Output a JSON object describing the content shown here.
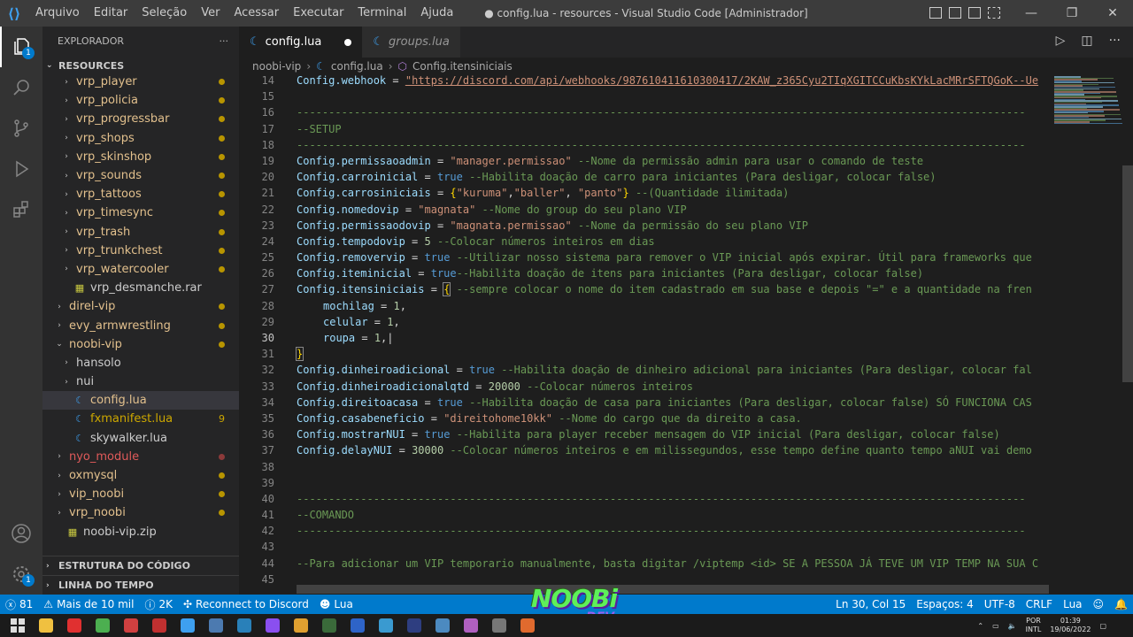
{
  "titlebar": {
    "menu": [
      "Arquivo",
      "Editar",
      "Seleção",
      "Ver",
      "Acessar",
      "Executar",
      "Terminal",
      "Ajuda"
    ],
    "title": "● config.lua - resources - Visual Studio Code [Administrador]"
  },
  "activitybar": {
    "explorer_badge": "1",
    "accounts_badge": "1"
  },
  "sidebar": {
    "title": "EXPLORADOR",
    "more": "···",
    "root": "RESOURCES",
    "items": [
      {
        "label": "vrp_player",
        "depth": 1,
        "twist": "›",
        "color": "#e2c08d",
        "dot": "#b89500"
      },
      {
        "label": "vrp_policia",
        "depth": 1,
        "twist": "›",
        "color": "#e2c08d",
        "dot": "#b89500"
      },
      {
        "label": "vrp_progressbar",
        "depth": 1,
        "twist": "›",
        "color": "#e2c08d",
        "dot": "#b89500"
      },
      {
        "label": "vrp_shops",
        "depth": 1,
        "twist": "›",
        "color": "#e2c08d",
        "dot": "#b89500"
      },
      {
        "label": "vrp_skinshop",
        "depth": 1,
        "twist": "›",
        "color": "#e2c08d",
        "dot": "#b89500"
      },
      {
        "label": "vrp_sounds",
        "depth": 1,
        "twist": "›",
        "color": "#e2c08d",
        "dot": "#b89500"
      },
      {
        "label": "vrp_tattoos",
        "depth": 1,
        "twist": "›",
        "color": "#e2c08d",
        "dot": "#b89500"
      },
      {
        "label": "vrp_timesync",
        "depth": 1,
        "twist": "›",
        "color": "#e2c08d",
        "dot": "#b89500"
      },
      {
        "label": "vrp_trash",
        "depth": 1,
        "twist": "›",
        "color": "#e2c08d",
        "dot": "#b89500"
      },
      {
        "label": "vrp_trunkchest",
        "depth": 1,
        "twist": "›",
        "color": "#e2c08d",
        "dot": "#b89500"
      },
      {
        "label": "vrp_watercooler",
        "depth": 1,
        "twist": "›",
        "color": "#e2c08d",
        "dot": "#b89500"
      },
      {
        "label": "vrp_desmanche.rar",
        "depth": 1,
        "twist": "",
        "icon": "▦",
        "icon_color": "#cbcb41",
        "color": "#cccccc"
      },
      {
        "label": "direl-vip",
        "depth": 0,
        "twist": "›",
        "color": "#e2c08d",
        "dot": "#b89500"
      },
      {
        "label": "evy_armwrestling",
        "depth": 0,
        "twist": "›",
        "color": "#e2c08d",
        "dot": "#b89500"
      },
      {
        "label": "noobi-vip",
        "depth": 0,
        "twist": "⌄",
        "color": "#e2c08d",
        "dot": "#b89500"
      },
      {
        "label": "hansolo",
        "depth": 1,
        "twist": "›",
        "color": "#cccccc"
      },
      {
        "label": "nui",
        "depth": 1,
        "twist": "›",
        "color": "#cccccc"
      },
      {
        "label": "config.lua",
        "depth": 1,
        "twist": "",
        "icon": "☾",
        "icon_color": "#3ea0f0",
        "color": "#e2c08d",
        "selected": true
      },
      {
        "label": "fxmanifest.lua",
        "depth": 1,
        "twist": "",
        "icon": "☾",
        "icon_color": "#3ea0f0",
        "color": "#cca700",
        "count": "9"
      },
      {
        "label": "skywalker.lua",
        "depth": 1,
        "twist": "",
        "icon": "☾",
        "icon_color": "#3ea0f0",
        "color": "#cccccc"
      },
      {
        "label": "nyo_module",
        "depth": 0,
        "twist": "›",
        "color": "#e05a5a",
        "dot": "#8c3a3a"
      },
      {
        "label": "oxmysql",
        "depth": 0,
        "twist": "›",
        "color": "#e2c08d",
        "dot": "#b89500"
      },
      {
        "label": "vip_noobi",
        "depth": 0,
        "twist": "›",
        "color": "#e2c08d",
        "dot": "#b89500"
      },
      {
        "label": "vrp_noobi",
        "depth": 0,
        "twist": "›",
        "color": "#e2c08d",
        "dot": "#b89500"
      },
      {
        "label": "noobi-vip.zip",
        "depth": 0,
        "twist": "",
        "icon": "▦",
        "icon_color": "#cbcb41",
        "color": "#cccccc"
      }
    ],
    "outline": "ESTRUTURA DO CÓDIGO",
    "timeline": "LINHA DO TEMPO"
  },
  "tabs": [
    {
      "label": "config.lua",
      "active": true,
      "modified": true
    },
    {
      "label": "groups.lua",
      "active": false
    }
  ],
  "breadcrumb": {
    "folder": "noobi-vip",
    "file": "config.lua",
    "symbol": "Config.itensiniciais"
  },
  "editor": {
    "lines": [
      {
        "n": 14,
        "t": [
          [
            "v",
            "Config.webhook"
          ],
          [
            "p",
            " = "
          ],
          [
            "u",
            "\"https://discord.com/api/webhooks/987610411610300417/2KAW_z365Cyu2TIqXGITCCuKbsKYkLacMRrSFTQGoK--Ue"
          ]
        ]
      },
      {
        "n": 15,
        "t": []
      },
      {
        "n": 16,
        "t": [
          [
            "c",
            "------------------------------------------------------------------------------------------------------------------"
          ]
        ]
      },
      {
        "n": 17,
        "t": [
          [
            "c",
            "--SETUP"
          ]
        ]
      },
      {
        "n": 18,
        "t": [
          [
            "c",
            "------------------------------------------------------------------------------------------------------------------"
          ]
        ]
      },
      {
        "n": 19,
        "t": [
          [
            "v",
            "Config.permissaoadmin"
          ],
          [
            "p",
            " = "
          ],
          [
            "s",
            "\"manager.permissao\""
          ],
          [
            "c",
            " --Nome da permissão admin para usar o comando de teste"
          ]
        ]
      },
      {
        "n": 20,
        "t": [
          [
            "v",
            "Config.carroinicial"
          ],
          [
            "p",
            " = "
          ],
          [
            "k",
            "true"
          ],
          [
            "c",
            " --Habilita doação de carro para iniciantes (Para desligar, colocar false)"
          ]
        ]
      },
      {
        "n": 21,
        "t": [
          [
            "v",
            "Config.carrosiniciais"
          ],
          [
            "p",
            " = "
          ],
          [
            "b",
            "{"
          ],
          [
            "s",
            "\"kuruma\""
          ],
          [
            "p",
            ","
          ],
          [
            "s",
            "\"baller\""
          ],
          [
            "p",
            ", "
          ],
          [
            "s",
            "\"panto\""
          ],
          [
            "b",
            "}"
          ],
          [
            "c",
            " --(Quantidade ilimitada)"
          ]
        ]
      },
      {
        "n": 22,
        "t": [
          [
            "v",
            "Config.nomedovip"
          ],
          [
            "p",
            " = "
          ],
          [
            "s",
            "\"magnata\""
          ],
          [
            "c",
            " --Nome do group do seu plano VIP"
          ]
        ]
      },
      {
        "n": 23,
        "t": [
          [
            "v",
            "Config.permissaodovip"
          ],
          [
            "p",
            " = "
          ],
          [
            "s",
            "\"magnata.permissao\""
          ],
          [
            "c",
            " --Nome da permissão do seu plano VIP"
          ]
        ]
      },
      {
        "n": 24,
        "t": [
          [
            "v",
            "Config.tempodovip"
          ],
          [
            "p",
            " = "
          ],
          [
            "n",
            "5"
          ],
          [
            "c",
            " --Colocar números inteiros em dias"
          ]
        ]
      },
      {
        "n": 25,
        "t": [
          [
            "v",
            "Config.removervip"
          ],
          [
            "p",
            " = "
          ],
          [
            "k",
            "true"
          ],
          [
            "c",
            " --Utilizar nosso sistema para remover o VIP inicial após expirar. Útil para frameworks que"
          ]
        ]
      },
      {
        "n": 26,
        "t": [
          [
            "v",
            "Config.iteminicial"
          ],
          [
            "p",
            " = "
          ],
          [
            "k",
            "true"
          ],
          [
            "c",
            "--Habilita doação de itens para iniciantes (Para desligar, colocar false)"
          ]
        ]
      },
      {
        "n": 27,
        "t": [
          [
            "v",
            "Config.itensiniciais"
          ],
          [
            "p",
            " = "
          ],
          [
            "h",
            "{"
          ],
          [
            "c",
            " --sempre colocar o nome do item cadastrado em sua base e depois \"=\" e a quantidade na fren"
          ]
        ]
      },
      {
        "n": 28,
        "t": [
          [
            "i",
            ""
          ],
          [
            "v",
            "mochilag"
          ],
          [
            "p",
            " = "
          ],
          [
            "n",
            "1"
          ],
          [
            "p",
            ","
          ]
        ]
      },
      {
        "n": 29,
        "t": [
          [
            "i",
            ""
          ],
          [
            "v",
            "celular"
          ],
          [
            "p",
            " = "
          ],
          [
            "n",
            "1"
          ],
          [
            "p",
            ","
          ]
        ]
      },
      {
        "n": 30,
        "t": [
          [
            "i",
            ""
          ],
          [
            "v",
            "roupa"
          ],
          [
            "p",
            " = "
          ],
          [
            "n",
            "1"
          ],
          [
            "p",
            ",|"
          ]
        ],
        "cur": true
      },
      {
        "n": 31,
        "t": [
          [
            "h",
            "}"
          ]
        ]
      },
      {
        "n": 32,
        "t": [
          [
            "v",
            "Config.dinheiroadicional"
          ],
          [
            "p",
            " = "
          ],
          [
            "k",
            "true"
          ],
          [
            "c",
            " --Habilita doação de dinheiro adicional para iniciantes (Para desligar, colocar fal"
          ]
        ]
      },
      {
        "n": 33,
        "t": [
          [
            "v",
            "Config.dinheiroadicionalqtd"
          ],
          [
            "p",
            " = "
          ],
          [
            "n",
            "20000"
          ],
          [
            "c",
            " --Colocar números inteiros"
          ]
        ]
      },
      {
        "n": 34,
        "t": [
          [
            "v",
            "Config.direitoacasa"
          ],
          [
            "p",
            " = "
          ],
          [
            "k",
            "true"
          ],
          [
            "c",
            " --Habilita doação de casa para iniciantes (Para desligar, colocar false) SÓ FUNCIONA CAS"
          ]
        ]
      },
      {
        "n": 35,
        "t": [
          [
            "v",
            "Config.casabeneficio"
          ],
          [
            "p",
            " = "
          ],
          [
            "s",
            "\"direitohome10kk\""
          ],
          [
            "c",
            " --Nome do cargo que da direito a casa."
          ]
        ]
      },
      {
        "n": 36,
        "t": [
          [
            "v",
            "Config.mostrarNUI"
          ],
          [
            "p",
            " = "
          ],
          [
            "k",
            "true"
          ],
          [
            "c",
            " --Habilita para player receber mensagem do VIP inicial (Para desligar, colocar false)"
          ]
        ]
      },
      {
        "n": 37,
        "t": [
          [
            "v",
            "Config.delayNUI"
          ],
          [
            "p",
            " = "
          ],
          [
            "n",
            "30000"
          ],
          [
            "c",
            " --Colocar números inteiros e em milissegundos, esse tempo define quanto tempo aNUI vai demo"
          ]
        ]
      },
      {
        "n": 38,
        "t": []
      },
      {
        "n": 39,
        "t": []
      },
      {
        "n": 40,
        "t": [
          [
            "c",
            "------------------------------------------------------------------------------------------------------------------"
          ]
        ]
      },
      {
        "n": 41,
        "t": [
          [
            "c",
            "--COMANDO"
          ]
        ]
      },
      {
        "n": 42,
        "t": [
          [
            "c",
            "------------------------------------------------------------------------------------------------------------------"
          ]
        ]
      },
      {
        "n": 43,
        "t": []
      },
      {
        "n": 44,
        "t": [
          [
            "c",
            "--Para adicionar um VIP temporario manualmente, basta digitar /viptemp <id> SE A PESSOA JÁ TEVE UM VIP TEMP NA SUA C"
          ]
        ]
      },
      {
        "n": 45,
        "t": []
      }
    ]
  },
  "statusbar": {
    "remote": "81",
    "info": "Mais de 10 mil",
    "info2": "2K",
    "discord": "Reconnect to Discord",
    "lang_left": "Lua",
    "position": "Ln 30, Col 15",
    "spaces": "Espaços: 4",
    "encoding": "UTF-8",
    "eol": "CRLF",
    "language": "Lua"
  },
  "taskbar": {
    "apps": [
      "#f0c040",
      "#e03030",
      "#4caf50",
      "#d04040",
      "#c03030",
      "#3ea0f0",
      "#4c7ab0",
      "#2980b9",
      "#8a4ff0",
      "#e0a030",
      "#3a6a3a",
      "#2e64c8",
      "#3a9ad0",
      "#2e3e80",
      "#4c8ac0",
      "#b060c0",
      "#777777",
      "#e06a2e"
    ],
    "lang1": "POR",
    "lang2": "INTL",
    "time": "01:39",
    "date": "19/06/2022"
  },
  "watermark": {
    "line1": "NOOBi",
    "line2": "DEV"
  }
}
